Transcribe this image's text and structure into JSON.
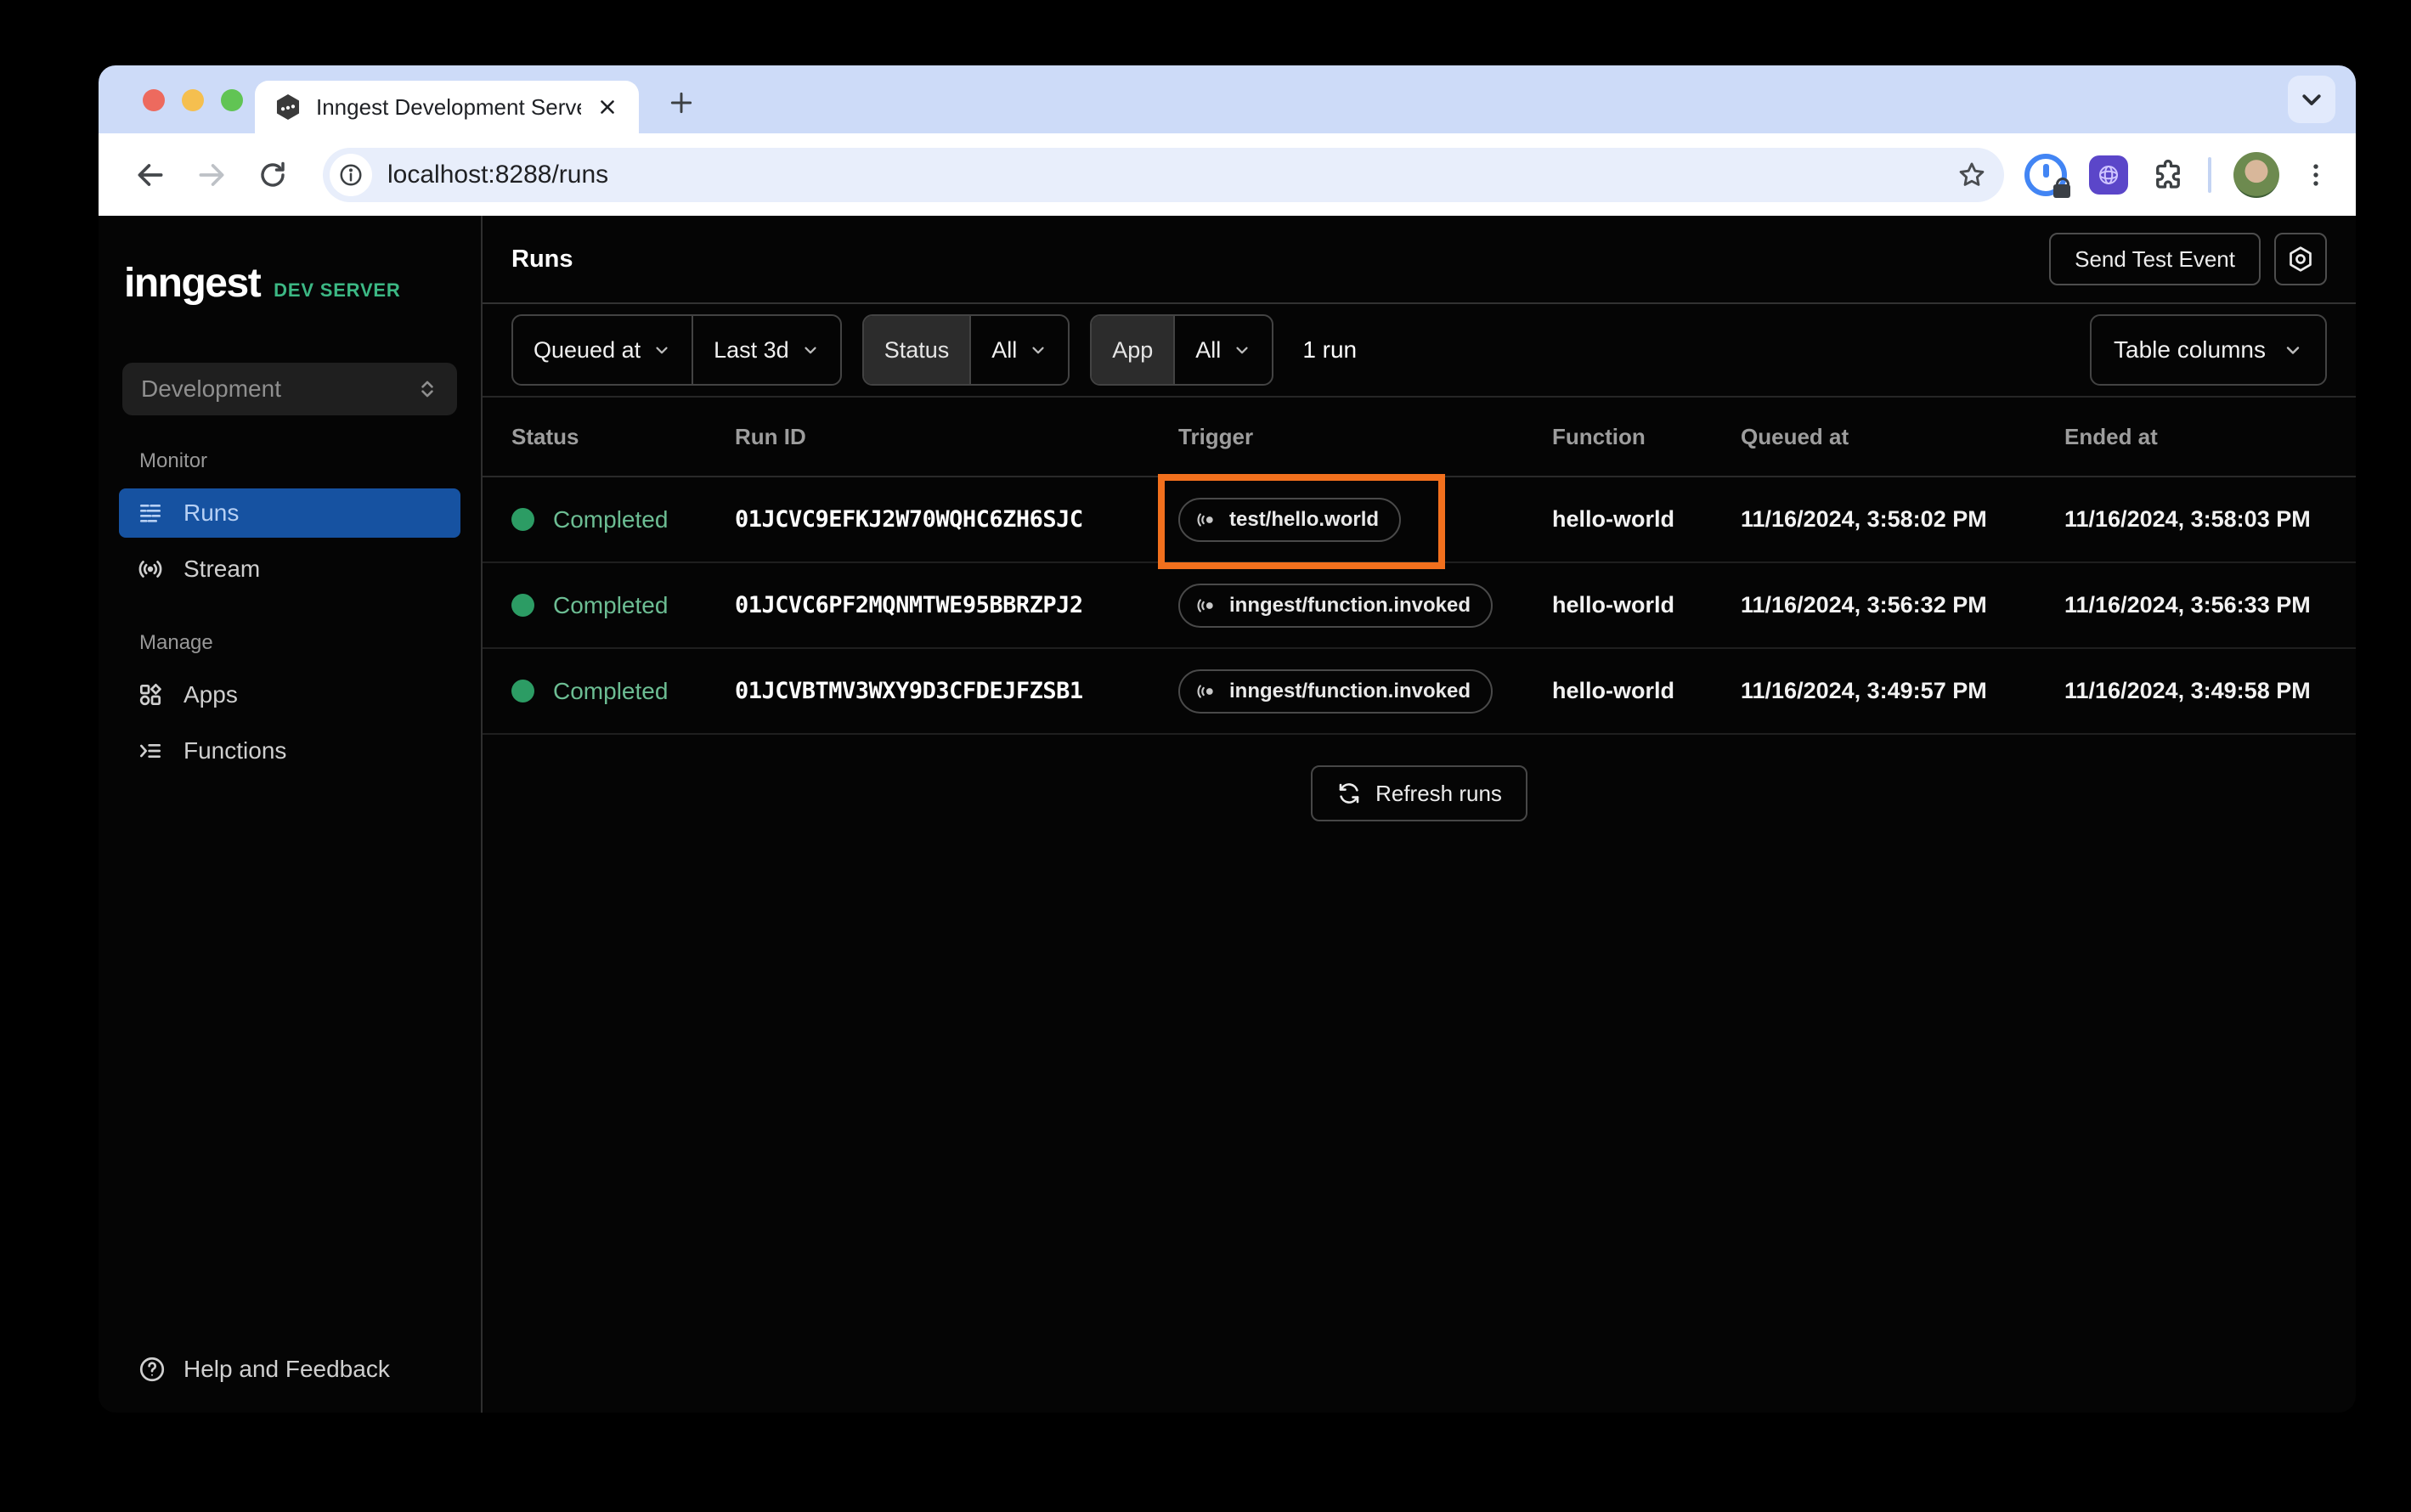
{
  "browser": {
    "tab_title": "Inngest Development Server",
    "url": "localhost:8288/runs"
  },
  "sidebar": {
    "logo_text": "inngest",
    "logo_badge": "DEV SERVER",
    "environment": "Development",
    "monitor_label": "Monitor",
    "manage_label": "Manage",
    "items": {
      "runs": "Runs",
      "stream": "Stream",
      "apps": "Apps",
      "functions": "Functions"
    },
    "help_label": "Help and Feedback"
  },
  "header": {
    "title": "Runs",
    "send_test_event": "Send Test Event"
  },
  "filters": {
    "queued_at": "Queued at",
    "time_range": "Last 3d",
    "status_label": "Status",
    "status_value": "All",
    "app_label": "App",
    "app_value": "All",
    "result_count": "1 run",
    "table_columns": "Table columns"
  },
  "table": {
    "columns": [
      "Status",
      "Run ID",
      "Trigger",
      "Function",
      "Queued at",
      "Ended at"
    ],
    "rows": [
      {
        "status": "Completed",
        "run_id": "01JCVC9EFKJ2W70WQHC6ZH6SJC",
        "trigger": "test/hello.world",
        "function": "hello-world",
        "queued_at": "11/16/2024, 3:58:02 PM",
        "ended_at": "11/16/2024, 3:58:03 PM",
        "highlighted": true
      },
      {
        "status": "Completed",
        "run_id": "01JCVC6PF2MQNMTWE95BBRZPJ2",
        "trigger": "inngest/function.invoked",
        "function": "hello-world",
        "queued_at": "11/16/2024, 3:56:32 PM",
        "ended_at": "11/16/2024, 3:56:33 PM",
        "highlighted": false
      },
      {
        "status": "Completed",
        "run_id": "01JCVBTMV3WXY9D3CFDEJFZSB1",
        "trigger": "inngest/function.invoked",
        "function": "hello-world",
        "queued_at": "11/16/2024, 3:49:57 PM",
        "ended_at": "11/16/2024, 3:49:58 PM",
        "highlighted": false
      }
    ],
    "refresh_label": "Refresh runs"
  },
  "colors": {
    "tabstrip_blue": "#cddbf8",
    "active_nav_blue": "#1652a1",
    "brand_green": "#3cb884",
    "status_green_text": "#6cbd93",
    "status_green_dot": "#2c9c64",
    "highlight_orange": "#f2701d"
  }
}
